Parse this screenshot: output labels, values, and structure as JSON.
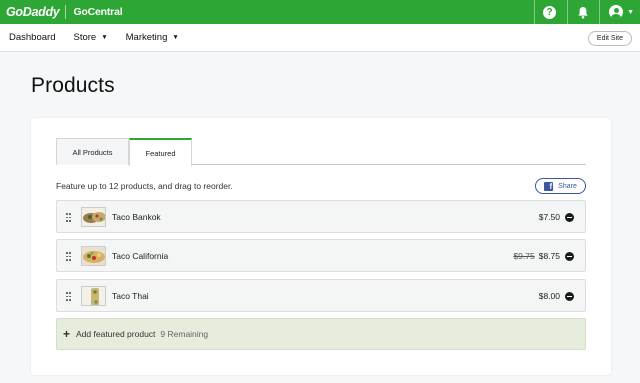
{
  "brand": {
    "logo": "GoDaddy",
    "product": "GoCentral",
    "help": "?"
  },
  "nav": {
    "items": [
      {
        "label": "Dashboard"
      },
      {
        "label": "Store"
      },
      {
        "label": "Marketing"
      }
    ],
    "edit_site": "Edit Site"
  },
  "page": {
    "title": "Products"
  },
  "tabs": [
    {
      "label": "All Products",
      "selected": false
    },
    {
      "label": "Featured",
      "selected": true
    }
  ],
  "featured": {
    "intro": "Feature up to 12 products, and drag to reorder.",
    "share_label": "Share",
    "products": [
      {
        "name": "Taco Bankok",
        "old_price": "",
        "price": "$7.50"
      },
      {
        "name": "Taco California",
        "old_price": "$9.75",
        "price": "$8.75"
      },
      {
        "name": "Taco Thai",
        "old_price": "",
        "price": "$8.00"
      }
    ],
    "add_label": "Add featured product",
    "remaining": "9 Remaining"
  },
  "colors": {
    "brand_green": "#2ea636",
    "facebook_blue": "#3b5998",
    "add_row_bg": "#e7eddd"
  }
}
